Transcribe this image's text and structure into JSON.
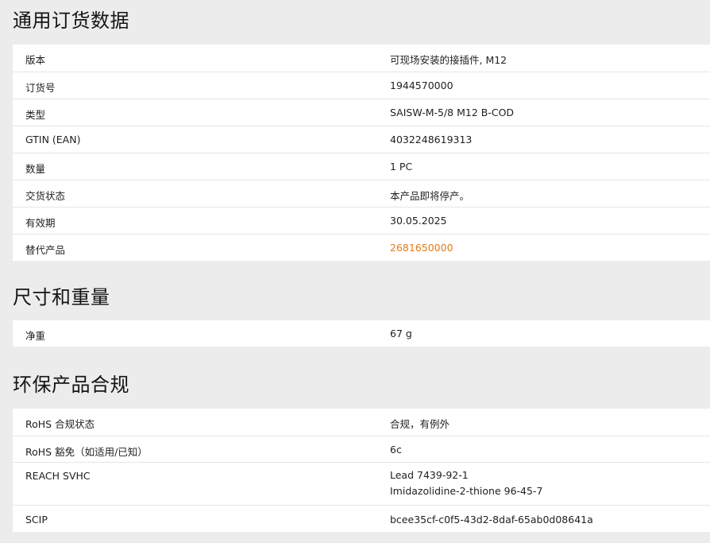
{
  "sections": [
    {
      "title": "通用订货数据",
      "rows": [
        {
          "label": "版本",
          "value": "可现场安装的接插件, M12"
        },
        {
          "label": "订货号",
          "value": "1944570000"
        },
        {
          "label": "类型",
          "value": "SAISW-M-5/8 M12 B-COD"
        },
        {
          "label": "GTIN (EAN)",
          "value": "4032248619313"
        },
        {
          "label": "数量",
          "value": "1  PC"
        },
        {
          "label": "交货状态",
          "value": "本产品即将停产。"
        },
        {
          "label": "有效期",
          "value": "30.05.2025"
        },
        {
          "label": "替代产品",
          "value": "2681650000",
          "link_color": "#e07b1a"
        }
      ]
    },
    {
      "title": "尺寸和重量",
      "rows": [
        {
          "label": "净重",
          "value": "67  g"
        }
      ]
    },
    {
      "title": "环保产品合规",
      "rows": [
        {
          "label": "RoHS 合规状态",
          "value": "合规，有例外"
        },
        {
          "label": "RoHS 豁免（如适用/已知）",
          "value": "6c"
        },
        {
          "label": "REACH SVHC",
          "value": "Lead 7439-92-1",
          "value2": "Imidazolidine-2-thione 96-45-7"
        },
        {
          "label": "SCIP",
          "value": "bcee35cf-c0f5-43d2-8daf-65ab0d08641a"
        }
      ]
    }
  ]
}
